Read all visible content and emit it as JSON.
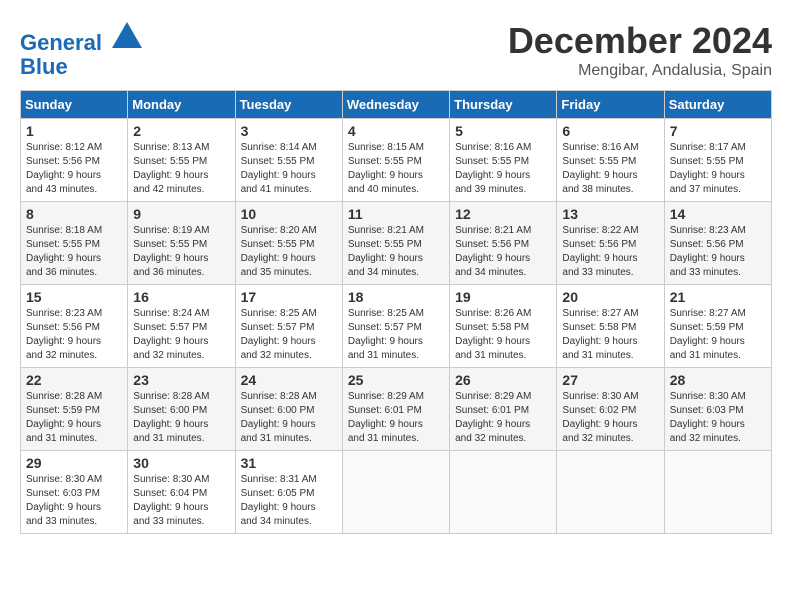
{
  "header": {
    "logo_line1": "General",
    "logo_line2": "Blue",
    "month_title": "December 2024",
    "subtitle": "Mengibar, Andalusia, Spain"
  },
  "weekdays": [
    "Sunday",
    "Monday",
    "Tuesday",
    "Wednesday",
    "Thursday",
    "Friday",
    "Saturday"
  ],
  "weeks": [
    [
      {
        "day": "1",
        "info": "Sunrise: 8:12 AM\nSunset: 5:56 PM\nDaylight: 9 hours\nand 43 minutes."
      },
      {
        "day": "2",
        "info": "Sunrise: 8:13 AM\nSunset: 5:55 PM\nDaylight: 9 hours\nand 42 minutes."
      },
      {
        "day": "3",
        "info": "Sunrise: 8:14 AM\nSunset: 5:55 PM\nDaylight: 9 hours\nand 41 minutes."
      },
      {
        "day": "4",
        "info": "Sunrise: 8:15 AM\nSunset: 5:55 PM\nDaylight: 9 hours\nand 40 minutes."
      },
      {
        "day": "5",
        "info": "Sunrise: 8:16 AM\nSunset: 5:55 PM\nDaylight: 9 hours\nand 39 minutes."
      },
      {
        "day": "6",
        "info": "Sunrise: 8:16 AM\nSunset: 5:55 PM\nDaylight: 9 hours\nand 38 minutes."
      },
      {
        "day": "7",
        "info": "Sunrise: 8:17 AM\nSunset: 5:55 PM\nDaylight: 9 hours\nand 37 minutes."
      }
    ],
    [
      {
        "day": "8",
        "info": "Sunrise: 8:18 AM\nSunset: 5:55 PM\nDaylight: 9 hours\nand 36 minutes."
      },
      {
        "day": "9",
        "info": "Sunrise: 8:19 AM\nSunset: 5:55 PM\nDaylight: 9 hours\nand 36 minutes."
      },
      {
        "day": "10",
        "info": "Sunrise: 8:20 AM\nSunset: 5:55 PM\nDaylight: 9 hours\nand 35 minutes."
      },
      {
        "day": "11",
        "info": "Sunrise: 8:21 AM\nSunset: 5:55 PM\nDaylight: 9 hours\nand 34 minutes."
      },
      {
        "day": "12",
        "info": "Sunrise: 8:21 AM\nSunset: 5:56 PM\nDaylight: 9 hours\nand 34 minutes."
      },
      {
        "day": "13",
        "info": "Sunrise: 8:22 AM\nSunset: 5:56 PM\nDaylight: 9 hours\nand 33 minutes."
      },
      {
        "day": "14",
        "info": "Sunrise: 8:23 AM\nSunset: 5:56 PM\nDaylight: 9 hours\nand 33 minutes."
      }
    ],
    [
      {
        "day": "15",
        "info": "Sunrise: 8:23 AM\nSunset: 5:56 PM\nDaylight: 9 hours\nand 32 minutes."
      },
      {
        "day": "16",
        "info": "Sunrise: 8:24 AM\nSunset: 5:57 PM\nDaylight: 9 hours\nand 32 minutes."
      },
      {
        "day": "17",
        "info": "Sunrise: 8:25 AM\nSunset: 5:57 PM\nDaylight: 9 hours\nand 32 minutes."
      },
      {
        "day": "18",
        "info": "Sunrise: 8:25 AM\nSunset: 5:57 PM\nDaylight: 9 hours\nand 31 minutes."
      },
      {
        "day": "19",
        "info": "Sunrise: 8:26 AM\nSunset: 5:58 PM\nDaylight: 9 hours\nand 31 minutes."
      },
      {
        "day": "20",
        "info": "Sunrise: 8:27 AM\nSunset: 5:58 PM\nDaylight: 9 hours\nand 31 minutes."
      },
      {
        "day": "21",
        "info": "Sunrise: 8:27 AM\nSunset: 5:59 PM\nDaylight: 9 hours\nand 31 minutes."
      }
    ],
    [
      {
        "day": "22",
        "info": "Sunrise: 8:28 AM\nSunset: 5:59 PM\nDaylight: 9 hours\nand 31 minutes."
      },
      {
        "day": "23",
        "info": "Sunrise: 8:28 AM\nSunset: 6:00 PM\nDaylight: 9 hours\nand 31 minutes."
      },
      {
        "day": "24",
        "info": "Sunrise: 8:28 AM\nSunset: 6:00 PM\nDaylight: 9 hours\nand 31 minutes."
      },
      {
        "day": "25",
        "info": "Sunrise: 8:29 AM\nSunset: 6:01 PM\nDaylight: 9 hours\nand 31 minutes."
      },
      {
        "day": "26",
        "info": "Sunrise: 8:29 AM\nSunset: 6:01 PM\nDaylight: 9 hours\nand 32 minutes."
      },
      {
        "day": "27",
        "info": "Sunrise: 8:30 AM\nSunset: 6:02 PM\nDaylight: 9 hours\nand 32 minutes."
      },
      {
        "day": "28",
        "info": "Sunrise: 8:30 AM\nSunset: 6:03 PM\nDaylight: 9 hours\nand 32 minutes."
      }
    ],
    [
      {
        "day": "29",
        "info": "Sunrise: 8:30 AM\nSunset: 6:03 PM\nDaylight: 9 hours\nand 33 minutes."
      },
      {
        "day": "30",
        "info": "Sunrise: 8:30 AM\nSunset: 6:04 PM\nDaylight: 9 hours\nand 33 minutes."
      },
      {
        "day": "31",
        "info": "Sunrise: 8:31 AM\nSunset: 6:05 PM\nDaylight: 9 hours\nand 34 minutes."
      },
      {
        "day": "",
        "info": ""
      },
      {
        "day": "",
        "info": ""
      },
      {
        "day": "",
        "info": ""
      },
      {
        "day": "",
        "info": ""
      }
    ]
  ]
}
